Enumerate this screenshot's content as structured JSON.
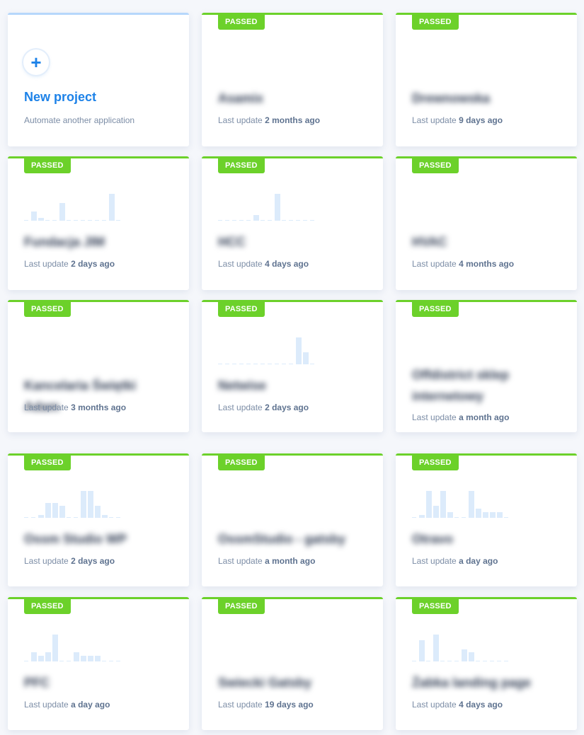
{
  "new_project": {
    "plus_icon": "+",
    "title": "New project",
    "subtitle": "Automate another application"
  },
  "last_update_prefix": "Last update",
  "projects": [
    {
      "status": "PASSED",
      "name": "Asamix",
      "updated": "2 months ago",
      "chart": []
    },
    {
      "status": "PASSED",
      "name": "Drewnowska",
      "updated": "9 days ago",
      "chart": []
    },
    {
      "status": "PASSED",
      "name": "Fundacja JIM",
      "updated": "2 days ago",
      "chart": [
        0,
        3,
        1,
        0,
        0,
        6,
        0,
        0,
        0,
        0,
        0,
        0,
        9,
        0
      ]
    },
    {
      "status": "PASSED",
      "name": "HCC",
      "updated": "4 days ago",
      "chart": [
        0,
        0,
        0,
        0,
        0,
        2,
        0,
        0,
        9,
        0,
        0,
        0,
        0,
        0
      ]
    },
    {
      "status": "PASSED",
      "name": "HVAC",
      "updated": "4 months ago",
      "chart": []
    },
    {
      "status": "PASSED",
      "name": "Kancelaria Świętki Adam",
      "updated": "3 months ago",
      "chart": []
    },
    {
      "status": "PASSED",
      "name": "Netwise",
      "updated": "2 days ago",
      "chart": [
        0,
        0,
        0,
        0,
        0,
        0,
        0,
        0,
        0,
        0,
        0,
        9,
        4,
        0
      ]
    },
    {
      "status": "PASSED",
      "name": "Offdistrict sklep internetowy",
      "updated": "a month ago",
      "chart": []
    },
    {
      "status": "PASSED",
      "name": "Ossm Studio WP",
      "updated": "2 days ago",
      "chart": [
        0,
        0,
        1,
        5,
        5,
        4,
        0,
        0,
        9,
        9,
        4,
        1,
        0,
        0
      ]
    },
    {
      "status": "PASSED",
      "name": "OssmStudio - gatsby",
      "updated": "a month ago",
      "chart": []
    },
    {
      "status": "PASSED",
      "name": "Otravo",
      "updated": "a day ago",
      "chart": [
        0,
        1,
        9,
        4,
        9,
        2,
        0,
        0,
        9,
        3,
        2,
        2,
        2,
        0
      ]
    },
    {
      "status": "PASSED",
      "name": "PFC",
      "updated": "a day ago",
      "chart": [
        0,
        3,
        2,
        3,
        9,
        0,
        0,
        3,
        2,
        2,
        2,
        0,
        0,
        0
      ]
    },
    {
      "status": "PASSED",
      "name": "Swiecki Gatsby",
      "updated": "19 days ago",
      "chart": []
    },
    {
      "status": "PASSED",
      "name": "Żabka landing page",
      "updated": "4 days ago",
      "chart": [
        0,
        7,
        0,
        9,
        0,
        0,
        0,
        4,
        3,
        0,
        0,
        0,
        0,
        0
      ]
    }
  ]
}
